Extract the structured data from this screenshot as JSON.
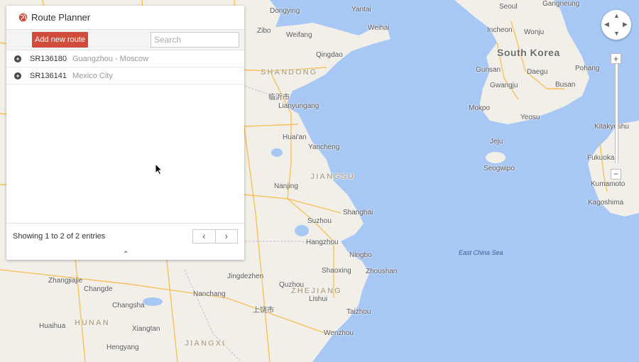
{
  "app": {
    "title": "Route Planner",
    "accent": "#d14d3b"
  },
  "toolbar": {
    "add_label": "Add new route",
    "search_placeholder": "Search",
    "search_value": ""
  },
  "routes": [
    {
      "id": "SR136180",
      "name": "Guangzhou - Moscow"
    },
    {
      "id": "SR136141",
      "name": "Mexico City"
    }
  ],
  "footer": {
    "entries_text": "Showing 1 to 2 of 2 entries"
  },
  "icons": {
    "logo": "globe-icon",
    "expand": "plus-circle-icon",
    "prev": "chevron-left-icon",
    "next": "chevron-right-icon",
    "collapse": "chevron-up-icon"
  },
  "map": {
    "colors": {
      "water": "#a7c8f5",
      "land": "#f2efe9",
      "road": "#f7c15a"
    },
    "labels": {
      "dongying": "Dongying",
      "yantai": "Yantai",
      "weihai": "Weihai",
      "weifang": "Weifang",
      "zibo": "Zibo",
      "qingdao": "Qingdao",
      "shandong": "SHANDONG",
      "linyi": "临沂市",
      "lianyungang": "Lianyungang",
      "huaian": "Huai'an",
      "yancheng": "Yancheng",
      "jiangsu": "JIANGSU",
      "nanjing": "Nanjing",
      "suzhou": "Suzhou",
      "shanghai": "Shanghai",
      "hangzhou": "Hangzhou",
      "ningbo": "Ningbo",
      "shaoxing": "Shaoxing",
      "zhoushan": "Zhoushan",
      "zhejiang": "ZHEJIANG",
      "quzhou": "Quzhou",
      "lishui": "Lishui",
      "taizhou": "Taizhou",
      "wenzhou": "Wenzhou",
      "jingdezhen": "Jingdezhen",
      "nanchang": "Nanchang",
      "shangrao": "上饶市",
      "jiangxi": "JIANGXI",
      "changsha": "Changsha",
      "hunan": "HUNAN",
      "zhangjiajie": "Zhangjiajie",
      "changde": "Changde",
      "xiangtan": "Xiangtan",
      "huaihua": "Huaihua",
      "hengyang": "Hengyang",
      "south_korea": "South Korea",
      "seoul": "Seoul",
      "incheon": "Incheon",
      "wonju": "Wonju",
      "gangneung": "Gangneung",
      "daegu": "Daegu",
      "pohang": "Pohang",
      "gunsan": "Gunsan",
      "gwangju": "Gwangju",
      "busan": "Busan",
      "mokpo": "Mokpo",
      "yeosu": "Yeosu",
      "jeju": "Jeju",
      "seogwipo": "Seogwipo",
      "kitakyushu": "Kitakyushu",
      "fukuoka": "Fukuoka",
      "kumamoto": "Kumamoto",
      "kagoshima": "Kagoshima",
      "east_china_sea": "East China Sea"
    }
  }
}
